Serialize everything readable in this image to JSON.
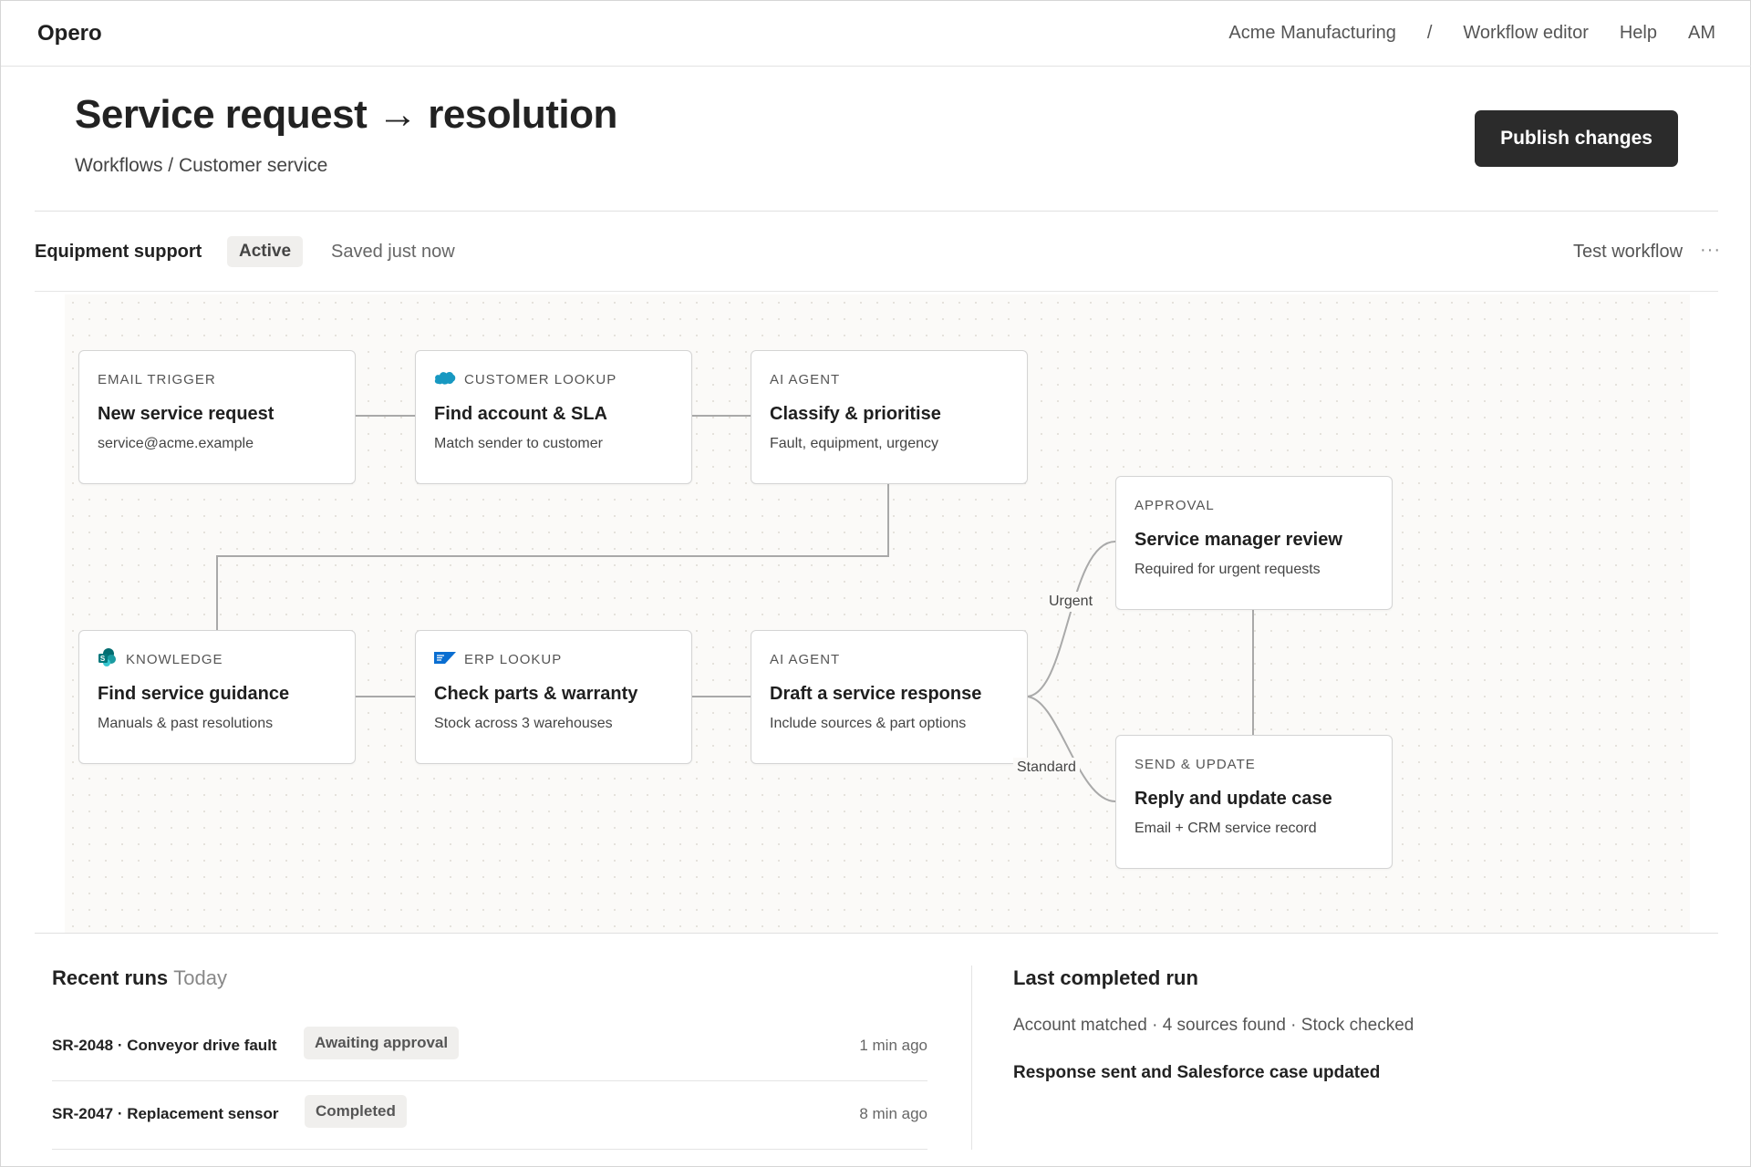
{
  "app": {
    "brand": "Opero"
  },
  "nav": {
    "org": "Acme Manufacturing",
    "separator": "/",
    "section": "Workflow editor",
    "help": "Help",
    "user_initials": "AM"
  },
  "header": {
    "title": "Service request → resolution",
    "breadcrumb": "Workflows / Customer service",
    "publish_label": "Publish changes"
  },
  "toolbar": {
    "workflow_name": "Equipment support",
    "status": "Active",
    "saved": "Saved just now",
    "test_label": "Test workflow",
    "more_label": "···"
  },
  "nodes": [
    {
      "type": "EMAIL TRIGGER",
      "title": "New service request",
      "sub": "service@acme.example",
      "icon": null
    },
    {
      "type": "CUSTOMER LOOKUP",
      "title": "Find account & SLA",
      "sub": "Match sender to customer",
      "icon": "salesforce-cloud-icon"
    },
    {
      "type": "AI AGENT",
      "title": "Classify & prioritise",
      "sub": "Fault, equipment, urgency",
      "icon": null
    },
    {
      "type": "KNOWLEDGE",
      "title": "Find service guidance",
      "sub": "Manuals & past resolutions",
      "icon": "sharepoint-icon"
    },
    {
      "type": "ERP LOOKUP",
      "title": "Check parts & warranty",
      "sub": "Stock across 3 warehouses",
      "icon": "sap-icon"
    },
    {
      "type": "AI AGENT",
      "title": "Draft a service response",
      "sub": "Include sources & part options",
      "icon": null
    },
    {
      "type": "APPROVAL",
      "title": "Service manager review",
      "sub": "Required for urgent requests",
      "icon": null
    },
    {
      "type": "SEND & UPDATE",
      "title": "Reply and update case",
      "sub": "Email + CRM service record",
      "icon": null
    }
  ],
  "edges": {
    "urgent": "Urgent",
    "standard": "Standard"
  },
  "recent_runs": {
    "title": "Recent runs",
    "subtitle": "Today",
    "rows": [
      {
        "name": "SR-2048 · Conveyor drive fault",
        "status": "Awaiting approval",
        "time": "1 min ago"
      },
      {
        "name": "SR-2047 · Replacement sensor",
        "status": "Completed",
        "time": "8 min ago"
      }
    ]
  },
  "last_run": {
    "title": "Last completed run",
    "meta": "Account matched · 4 sources found · Stock checked",
    "result": "Response sent and Salesforce case updated"
  },
  "colors": {
    "primary_button": "#2b2b2b",
    "salesforce": "#1798c1",
    "sharepoint": "#0b7a75",
    "sap": "#0a6ed1"
  }
}
